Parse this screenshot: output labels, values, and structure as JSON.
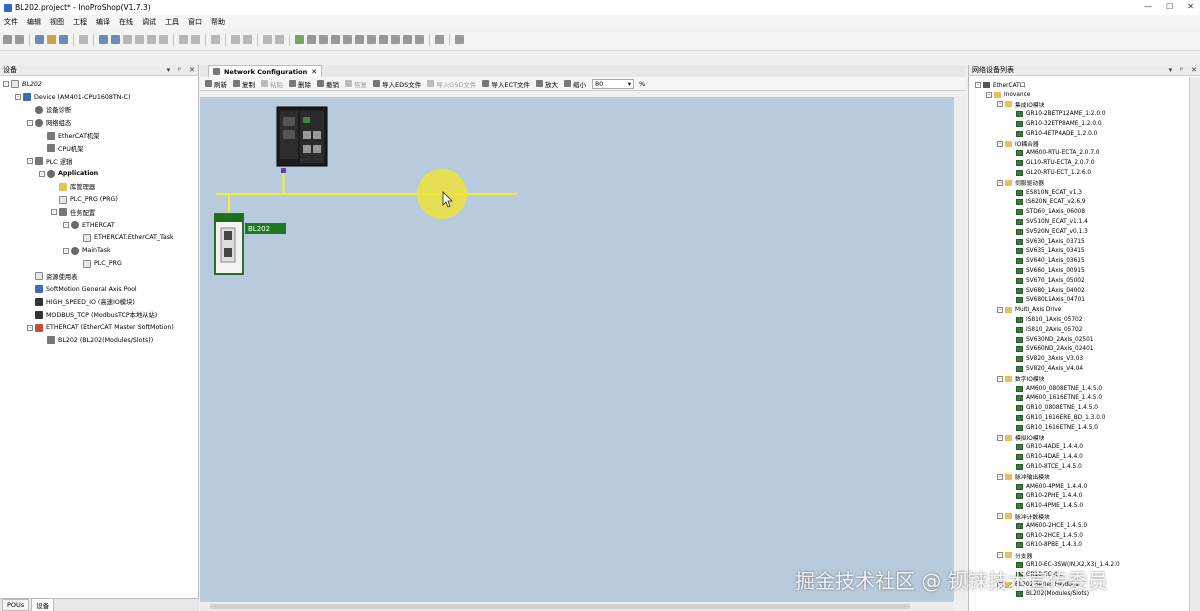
{
  "window": {
    "title": "BL202.project* - InoProShop(V1.7.3)",
    "controls": [
      "—",
      "☐",
      "✕"
    ]
  },
  "menu": [
    "文件",
    "编辑",
    "视图",
    "工程",
    "编译",
    "在线",
    "调试",
    "工具",
    "窗口",
    "帮助"
  ],
  "left_panel": {
    "title": "设备",
    "tree": [
      {
        "label": "BL202",
        "indent": 0,
        "expander": "-",
        "icon": "doc",
        "bold": false
      },
      {
        "label": "Device (AM401-CPU1608TN-C)",
        "indent": 1,
        "expander": "-",
        "icon": "blue"
      },
      {
        "label": "设备诊断",
        "indent": 2,
        "expander": "",
        "icon": "gear"
      },
      {
        "label": "网络组态",
        "indent": 2,
        "expander": "-",
        "icon": "gear"
      },
      {
        "label": "EtherCAT机架",
        "indent": 3,
        "expander": "",
        "icon": "chip"
      },
      {
        "label": "CPU机架",
        "indent": 3,
        "expander": "",
        "icon": "chip"
      },
      {
        "label": "PLC 逻辑",
        "indent": 2,
        "expander": "-",
        "icon": "chip"
      },
      {
        "label": "Application",
        "indent": 3,
        "expander": "-",
        "icon": "gear",
        "bold": true
      },
      {
        "label": "库管理器",
        "indent": 4,
        "expander": "",
        "icon": "folder"
      },
      {
        "label": "PLC_PRG (PRG)",
        "indent": 4,
        "expander": "",
        "icon": "doc"
      },
      {
        "label": "任务配置",
        "indent": 4,
        "expander": "-",
        "icon": "chip"
      },
      {
        "label": "ETHERCAT",
        "indent": 5,
        "expander": "-",
        "icon": "gear"
      },
      {
        "label": "ETHERCAT.EtherCAT_Task",
        "indent": 6,
        "expander": "",
        "icon": "doc"
      },
      {
        "label": "MainTask",
        "indent": 5,
        "expander": "-",
        "icon": "gear"
      },
      {
        "label": "PLC_PRG",
        "indent": 6,
        "expander": "",
        "icon": "doc"
      },
      {
        "label": "资源使用表",
        "indent": 2,
        "expander": "",
        "icon": "doc"
      },
      {
        "label": "SoftMotion General Axis Pool",
        "indent": 2,
        "expander": "",
        "icon": "blue"
      },
      {
        "label": "HIGH_SPEED_IO (高速IO模块)",
        "indent": 2,
        "expander": "",
        "icon": "dark"
      },
      {
        "label": "MODBUS_TCP (ModbusTCP本地从站)",
        "indent": 2,
        "expander": "",
        "icon": "dark"
      },
      {
        "label": "ETHERCAT (EtherCAT Master SoftMotion)",
        "indent": 2,
        "expander": "-",
        "icon": "red"
      },
      {
        "label": "BL202 (BL202(Modules/Slots))",
        "indent": 3,
        "expander": "",
        "icon": "chip"
      }
    ],
    "tabs": [
      {
        "label": "POUs",
        "active": false
      },
      {
        "label": "设备",
        "active": true
      }
    ]
  },
  "editor": {
    "tab_label": "Network Configuration",
    "toolbar": [
      {
        "label": "刷新",
        "disabled": false
      },
      {
        "label": "复制",
        "disabled": false
      },
      {
        "label": "粘贴",
        "disabled": true
      },
      {
        "label": "删除",
        "disabled": false
      },
      {
        "label": "撤销",
        "disabled": false
      },
      {
        "label": "恢复",
        "disabled": true
      },
      {
        "label": "导入EDS文件",
        "disabled": false
      },
      {
        "label": "导入GSD文件",
        "disabled": true
      },
      {
        "label": "导入ECT文件",
        "disabled": false
      },
      {
        "label": "放大",
        "disabled": false
      },
      {
        "label": "缩小",
        "disabled": false
      }
    ],
    "zoom_value": "80",
    "zoom_unit": "%",
    "slave_label": "BL202"
  },
  "right_panel": {
    "title": "网络设备列表",
    "tree": [
      {
        "label": "EtherCAT口",
        "indent": 0,
        "expander": "-",
        "icon": "net"
      },
      {
        "label": "Inovance",
        "indent": 1,
        "expander": "-",
        "icon": "folder"
      },
      {
        "label": "集成IO模块",
        "indent": 2,
        "expander": "-",
        "icon": "folder"
      },
      {
        "label": "GR10-2BETP12AME_1.2.0.0",
        "indent": 3,
        "expander": "",
        "icon": "mod"
      },
      {
        "label": "GR10-32ETP8AME_1.2.0.0",
        "indent": 3,
        "expander": "",
        "icon": "mod"
      },
      {
        "label": "GR10-4ETP4ADE_1.2.0.0",
        "indent": 3,
        "expander": "",
        "icon": "mod"
      },
      {
        "label": "IO耦合器",
        "indent": 2,
        "expander": "-",
        "icon": "folder"
      },
      {
        "label": "AM600-RTU-ECTA_2.0.7.0",
        "indent": 3,
        "expander": "",
        "icon": "mod"
      },
      {
        "label": "GL10-RTU-ECTA_2.0.7.0",
        "indent": 3,
        "expander": "",
        "icon": "mod"
      },
      {
        "label": "GL20-RTU-ECT_1.2.6.0",
        "indent": 3,
        "expander": "",
        "icon": "mod"
      },
      {
        "label": "伺服驱动器",
        "indent": 2,
        "expander": "-",
        "icon": "folder"
      },
      {
        "label": "ES810N_ECAT_v1.3",
        "indent": 3,
        "expander": "",
        "icon": "mod"
      },
      {
        "label": "IS620N_ECAT_v2.6.9",
        "indent": 3,
        "expander": "",
        "icon": "mod"
      },
      {
        "label": "STD60_1Axis_06008",
        "indent": 3,
        "expander": "",
        "icon": "mod"
      },
      {
        "label": "SV510N_ECAT_v1.1.4",
        "indent": 3,
        "expander": "",
        "icon": "mod"
      },
      {
        "label": "SV520N_ECAT_v0.1.3",
        "indent": 3,
        "expander": "",
        "icon": "mod"
      },
      {
        "label": "SV630_1Axis_03715",
        "indent": 3,
        "expander": "",
        "icon": "mod"
      },
      {
        "label": "SV635_1Axis_03415",
        "indent": 3,
        "expander": "",
        "icon": "mod"
      },
      {
        "label": "SV640_1Axis_03615",
        "indent": 3,
        "expander": "",
        "icon": "mod"
      },
      {
        "label": "SV660_1Axis_00915",
        "indent": 3,
        "expander": "",
        "icon": "mod"
      },
      {
        "label": "SV670_1Axis_05002",
        "indent": 3,
        "expander": "",
        "icon": "mod"
      },
      {
        "label": "SV680_1Axis_04002",
        "indent": 3,
        "expander": "",
        "icon": "mod"
      },
      {
        "label": "SV680L1Axis_04701",
        "indent": 3,
        "expander": "",
        "icon": "mod"
      },
      {
        "label": "Multi_Axis Drive",
        "indent": 2,
        "expander": "-",
        "icon": "folder"
      },
      {
        "label": "IS810_1Axis_05702",
        "indent": 3,
        "expander": "",
        "icon": "mod"
      },
      {
        "label": "IS810_2Axis_05702",
        "indent": 3,
        "expander": "",
        "icon": "mod"
      },
      {
        "label": "SV630ND_2Axis_02501",
        "indent": 3,
        "expander": "",
        "icon": "mod"
      },
      {
        "label": "SV660ND_2Axis_02401",
        "indent": 3,
        "expander": "",
        "icon": "mod"
      },
      {
        "label": "SV820_3Axis_V3.03",
        "indent": 3,
        "expander": "",
        "icon": "mod"
      },
      {
        "label": "SV820_4Axis_V4.04",
        "indent": 3,
        "expander": "",
        "icon": "mod"
      },
      {
        "label": "数字IO模块",
        "indent": 2,
        "expander": "-",
        "icon": "folder"
      },
      {
        "label": "AM600_0808ETNE_1.4.5.0",
        "indent": 3,
        "expander": "",
        "icon": "mod"
      },
      {
        "label": "AM600_1616ETNE_1.4.5.0",
        "indent": 3,
        "expander": "",
        "icon": "mod"
      },
      {
        "label": "GR10_0808ETNE_1.4.5.0",
        "indent": 3,
        "expander": "",
        "icon": "mod"
      },
      {
        "label": "GR10_1616ERE_BD_1.3.0.0",
        "indent": 3,
        "expander": "",
        "icon": "mod"
      },
      {
        "label": "GR10_1616ETNE_1.4.5.0",
        "indent": 3,
        "expander": "",
        "icon": "mod"
      },
      {
        "label": "模拟IO模块",
        "indent": 2,
        "expander": "-",
        "icon": "folder"
      },
      {
        "label": "GR10-4ADE_1.4.4.0",
        "indent": 3,
        "expander": "",
        "icon": "mod"
      },
      {
        "label": "GR10-4DAE_1.4.4.0",
        "indent": 3,
        "expander": "",
        "icon": "mod"
      },
      {
        "label": "GR10-8TCE_1.4.5.0",
        "indent": 3,
        "expander": "",
        "icon": "mod"
      },
      {
        "label": "脉冲输出模块",
        "indent": 2,
        "expander": "-",
        "icon": "folder"
      },
      {
        "label": "AM600-4PME_1.4.4.0",
        "indent": 3,
        "expander": "",
        "icon": "mod"
      },
      {
        "label": "GR10-2PHE_1.4.4.0",
        "indent": 3,
        "expander": "",
        "icon": "mod"
      },
      {
        "label": "GR10-4PME_1.4.5.0",
        "indent": 3,
        "expander": "",
        "icon": "mod"
      },
      {
        "label": "脉冲计数模块",
        "indent": 2,
        "expander": "-",
        "icon": "folder"
      },
      {
        "label": "AM600-2HCE_1.4.5.0",
        "indent": 3,
        "expander": "",
        "icon": "mod"
      },
      {
        "label": "GR10-2HCE_1.4.5.0",
        "indent": 3,
        "expander": "",
        "icon": "mod"
      },
      {
        "label": "GR10-8PBE_1.4.3.0",
        "indent": 3,
        "expander": "",
        "icon": "mod"
      },
      {
        "label": "分支器",
        "indent": 2,
        "expander": "-",
        "icon": "folder"
      },
      {
        "label": "GR10-EC-3SW(IN,X2,X3)_1.4.2.0",
        "indent": 3,
        "expander": "",
        "icon": "mod"
      },
      {
        "label": "GR10-EC-4...",
        "indent": 3,
        "expander": "",
        "icon": "mod"
      },
      {
        "label": "BL202 Series Fieldbus",
        "indent": 2,
        "expander": "-",
        "icon": "folder"
      },
      {
        "label": "BL202(Modules/Slots)",
        "indent": 3,
        "expander": "",
        "icon": "mod"
      }
    ]
  },
  "watermark": "掘金技术社区 @ 钡铼技术宣传委员"
}
